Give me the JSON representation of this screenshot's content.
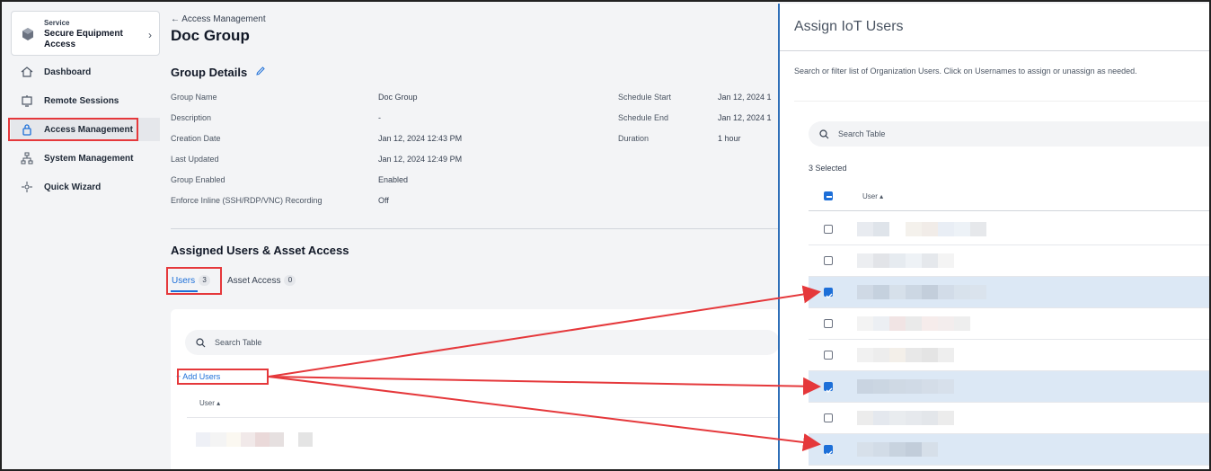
{
  "sidebar": {
    "service_label": "Service",
    "service_name": "Secure Equipment Access",
    "items": [
      {
        "label": "Dashboard",
        "icon": "home-icon"
      },
      {
        "label": "Remote Sessions",
        "icon": "remote-session-icon"
      },
      {
        "label": "Access Management",
        "icon": "lock-icon"
      },
      {
        "label": "System Management",
        "icon": "network-icon"
      },
      {
        "label": "Quick Wizard",
        "icon": "wizard-icon"
      }
    ]
  },
  "main": {
    "breadcrumb": "← Access Management",
    "title": "Doc Group",
    "group_details_title": "Group Details",
    "details": [
      {
        "label": "Group Name",
        "value": "Doc Group"
      },
      {
        "label": "Description",
        "value": "-"
      },
      {
        "label": "Creation Date",
        "value": "Jan 12, 2024 12:43 PM"
      },
      {
        "label": "Last Updated",
        "value": "Jan 12, 2024 12:49 PM"
      },
      {
        "label": "Group Enabled",
        "value": "Enabled"
      },
      {
        "label": "Enforce Inline (SSH/RDP/VNC) Recording",
        "value": "Off"
      }
    ],
    "schedule": [
      {
        "label": "Schedule Start",
        "value": "Jan 12, 2024 1"
      },
      {
        "label": "Schedule End",
        "value": "Jan 12, 2024 1"
      },
      {
        "label": "Duration",
        "value": "1 hour"
      }
    ],
    "assigned_title": "Assigned Users & Asset Access",
    "tabs": [
      {
        "label": "Users",
        "count": "3"
      },
      {
        "label": "Asset Access",
        "count": "0"
      }
    ],
    "search_placeholder": "Search Table",
    "add_users_label": "+ Add Users",
    "user_col_header": "User ▴"
  },
  "panel": {
    "title": "Assign IoT Users",
    "description": "Search or filter list of Organization Users. Click on Usernames to assign or unassign as needed.",
    "search_placeholder": "Search Table",
    "selected_count": "3 Selected",
    "user_col_header": "User ▴",
    "rows_selected": [
      false,
      false,
      true,
      false,
      false,
      true,
      false,
      true
    ]
  },
  "colors": {
    "accent": "#1d6fd8",
    "highlight": "#e5383b",
    "selected_row": "#dce8f5"
  }
}
